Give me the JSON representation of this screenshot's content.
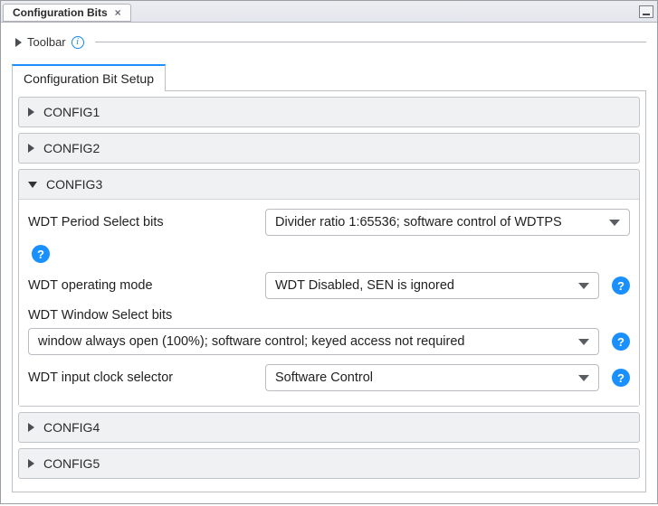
{
  "window": {
    "title": "Configuration Bits"
  },
  "toolbar": {
    "label": "Toolbar"
  },
  "tabs": [
    {
      "label": "Configuration Bit Setup",
      "active": true
    }
  ],
  "sections": [
    {
      "id": "config1",
      "title": "CONFIG1",
      "expanded": false
    },
    {
      "id": "config2",
      "title": "CONFIG2",
      "expanded": false
    },
    {
      "id": "config3",
      "title": "CONFIG3",
      "expanded": true,
      "fields": [
        {
          "id": "wdt_period",
          "label": "WDT Period Select bits",
          "value": "Divider ratio 1:65536; software control of WDTPS",
          "help_below": true
        },
        {
          "id": "wdt_mode",
          "label": "WDT operating mode",
          "value": "WDT Disabled, SEN is ignored",
          "help": true
        },
        {
          "id": "wdt_window",
          "label": "WDT Window Select bits",
          "value": "window always open (100%); software control; keyed access not required",
          "stacked": true,
          "help": true
        },
        {
          "id": "wdt_clock",
          "label": "WDT input clock selector",
          "value": "Software Control",
          "help": true
        }
      ]
    },
    {
      "id": "config4",
      "title": "CONFIG4",
      "expanded": false
    },
    {
      "id": "config5",
      "title": "CONFIG5",
      "expanded": false
    }
  ]
}
